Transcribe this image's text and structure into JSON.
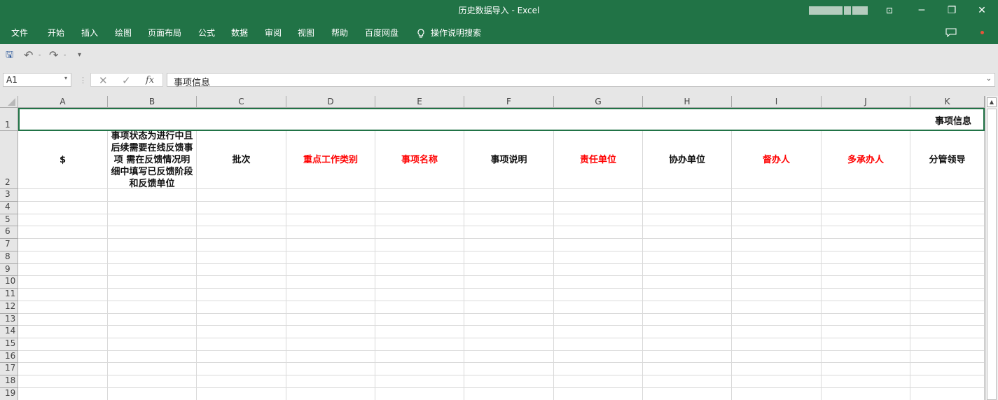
{
  "window": {
    "title": "历史数据导入  -  Excel",
    "controls": {
      "restore_ribbon": "⊡",
      "minimize": "─",
      "maximize": "❐",
      "close": "✕"
    }
  },
  "ribbon": {
    "tabs": [
      "文件",
      "开始",
      "插入",
      "绘图",
      "页面布局",
      "公式",
      "数据",
      "审阅",
      "视图",
      "帮助",
      "百度网盘"
    ],
    "tell_me": "操作说明搜索"
  },
  "qat": {
    "save": "🖫",
    "undo": "↶",
    "redo": "↷",
    "more": "▾",
    "sep": "-"
  },
  "formula_bar": {
    "name_box": "A1",
    "name_dropdown": "▾",
    "separator": "⋮",
    "cancel": "✕",
    "enter": "✓",
    "fx": "fx",
    "value": "事项信息",
    "expand": "⌄"
  },
  "sheet": {
    "columns": [
      "A",
      "B",
      "C",
      "D",
      "E",
      "F",
      "G",
      "H",
      "I",
      "J",
      "K"
    ],
    "rows": [
      "1",
      "2",
      "3",
      "4",
      "5",
      "6",
      "7",
      "8",
      "9",
      "10",
      "11",
      "12",
      "13",
      "14",
      "15",
      "16",
      "17",
      "18",
      "19"
    ],
    "title_cell": "事项信息",
    "header_row": [
      {
        "text": "$",
        "color": "#111111"
      },
      {
        "text": "事项状态为进行中且后续需要在线反馈事项 需在反馈情况明细中填写已反馈阶段和反馈单位",
        "color": "#111111"
      },
      {
        "text": "批次",
        "color": "#111111"
      },
      {
        "text": "重点工作类别",
        "color": "#ff0000"
      },
      {
        "text": "事项名称",
        "color": "#ff0000"
      },
      {
        "text": "事项说明",
        "color": "#111111"
      },
      {
        "text": "责任单位",
        "color": "#ff0000"
      },
      {
        "text": "协办单位",
        "color": "#111111"
      },
      {
        "text": "督办人",
        "color": "#ff0000"
      },
      {
        "text": "多承办人",
        "color": "#ff0000"
      },
      {
        "text": "分管领导",
        "color": "#111111"
      }
    ]
  },
  "colors": {
    "excel_green": "#217346",
    "required_red": "#ff0000"
  }
}
